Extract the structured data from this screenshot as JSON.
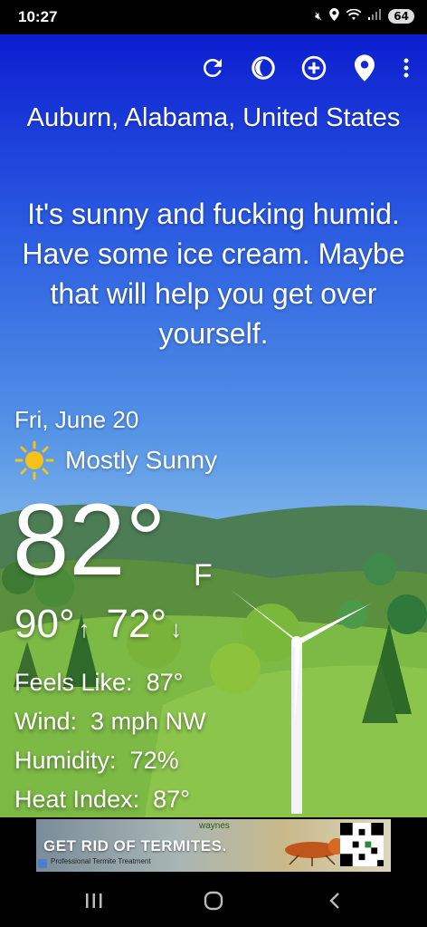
{
  "status_bar": {
    "time": "10:27",
    "battery": "64"
  },
  "toolbar": {
    "refresh_icon": "refresh-icon",
    "theme_icon": "theme-icon",
    "add_icon": "add-location-icon",
    "location_icon": "location-pin-icon",
    "more_icon": "more-vert-icon"
  },
  "weather": {
    "location": "Auburn, Alabama, United States",
    "message": "It's sunny and fucking humid. Have some ice cream. Maybe that will help you get over yourself.",
    "date": "Fri, June 20",
    "condition": "Mostly Sunny",
    "temperature": "82°",
    "unit": "F",
    "high": "90°",
    "low": "72°",
    "details": [
      {
        "label": "Feels Like:",
        "value": "87°"
      },
      {
        "label": "Wind:",
        "value": "3 mph NW"
      },
      {
        "label": "Humidity:",
        "value": "72%"
      },
      {
        "label": "Heat Index:",
        "value": "87°"
      }
    ]
  },
  "ad": {
    "brand": "waynes",
    "title": "GET RID OF TERMITES.",
    "subtitle": "Professional Termite Treatment"
  },
  "colors": {
    "sky_top": "#0c1ed0",
    "sky_bottom": "#9ecbe8",
    "grass": "#7fc24a",
    "sun": "#f6c21a"
  }
}
